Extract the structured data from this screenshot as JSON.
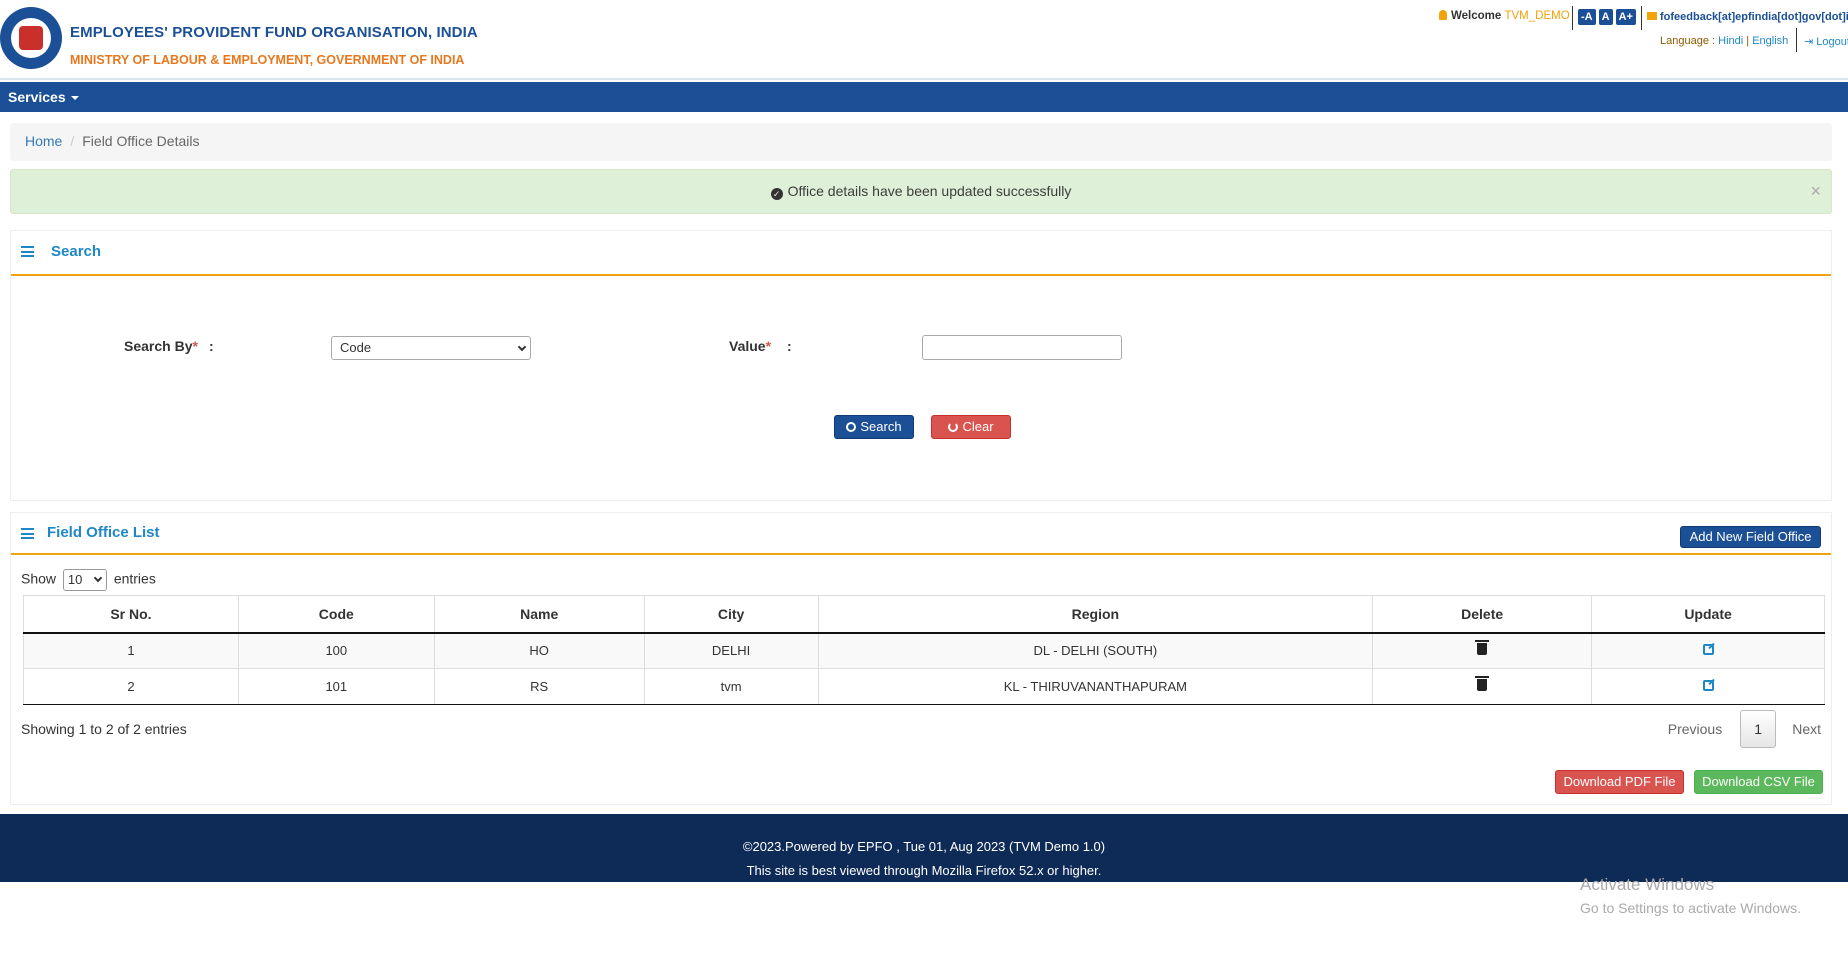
{
  "header": {
    "org_title": "EMPLOYEES' PROVIDENT FUND ORGANISATION, INDIA",
    "ministry": "MINISTRY OF LABOUR & EMPLOYMENT, GOVERNMENT OF INDIA",
    "welcome_label": "Welcome",
    "username": "TVM_DEMO",
    "font_buttons": [
      "-A",
      "A",
      "A+"
    ],
    "feedback_email": "fofeedback[at]epfindia[dot]gov[dot]in",
    "language_label": "Language :",
    "lang_hindi": "Hindi",
    "lang_english": "English",
    "logout_label": "Logout"
  },
  "navbar": {
    "services_label": "Services"
  },
  "breadcrumb": {
    "home": "Home",
    "current": "Field Office Details"
  },
  "alert": {
    "message": "Office details have been updated successfully",
    "close": "×"
  },
  "search_panel": {
    "title": "Search",
    "search_by_label": "Search By",
    "value_label": "Value",
    "required_mark": "*",
    "colon": ":",
    "search_by_selected": "Code",
    "value_input": "",
    "search_button": "Search",
    "clear_button": "Clear"
  },
  "list_panel": {
    "title": "Field Office List",
    "add_button": "Add New Field Office",
    "show_label": "Show",
    "entries_label": "entries",
    "page_length": "10",
    "columns": [
      "Sr No.",
      "Code",
      "Name",
      "City",
      "Region",
      "Delete",
      "Update"
    ],
    "rows": [
      {
        "sr": "1",
        "code": "100",
        "name": "HO",
        "city": "DELHI",
        "region": "DL - DELHI (SOUTH)"
      },
      {
        "sr": "2",
        "code": "101",
        "name": "RS",
        "city": "tvm",
        "region": "KL - THIRUVANANTHAPURAM"
      }
    ],
    "info": "Showing 1 to 2 of 2 entries",
    "prev": "Previous",
    "page": "1",
    "next": "Next",
    "pdf_button": "Download PDF File",
    "csv_button": "Download CSV File"
  },
  "footer": {
    "line1": "©2023.Powered by EPFO , Tue 01, Aug 2023 (TVM Demo 1.0)",
    "line2": "This site is best viewed through Mozilla Firefox 52.x or higher."
  },
  "watermark": {
    "line1": "Activate Windows",
    "line2": "Go to Settings to activate Windows."
  }
}
